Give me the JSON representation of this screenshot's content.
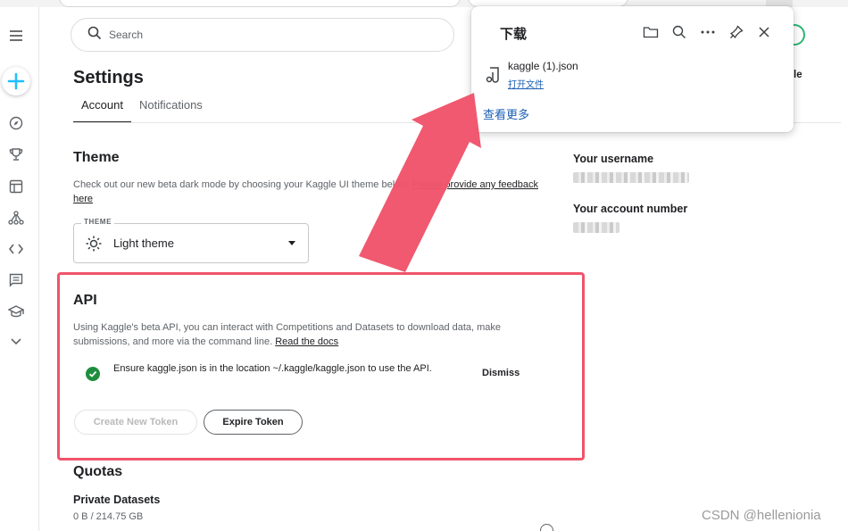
{
  "search": {
    "placeholder": "Search"
  },
  "page": {
    "title": "Settings"
  },
  "tabs": [
    {
      "label": "Account",
      "active": true
    },
    {
      "label": "Notifications",
      "active": false
    }
  ],
  "theme": {
    "heading": "Theme",
    "desc_text": "Check out our new beta dark mode by choosing your Kaggle UI theme below.",
    "desc_link": "Please provide any feedback here",
    "select_legend": "THEME",
    "select_value": "Light theme"
  },
  "account": {
    "username_label": "Your username",
    "number_label": "Your account number"
  },
  "api": {
    "heading": "API",
    "desc_text": "Using Kaggle's beta API, you can interact with Competitions and Datasets to download data, make submissions, and more via the command line.",
    "desc_link": "Read the docs",
    "notice": "Ensure kaggle.json is in the location ~/.kaggle/kaggle.json to use the API.",
    "dismiss": "Dismiss",
    "create_token": "Create New Token",
    "expire_token": "Expire Token"
  },
  "quotas": {
    "heading": "Quotas",
    "private_datasets_label": "Private Datasets",
    "private_datasets_value": "0 B / 214.75 GB"
  },
  "downloads": {
    "title": "下载",
    "file_name": "kaggle (1).json",
    "open_file": "打开文件",
    "see_more": "查看更多"
  },
  "header_partial": {
    "name_fragment": "le"
  },
  "watermark": "CSDN @hellenionia",
  "colors": {
    "accent_blue": "#20beff",
    "highlight_red": "#f0546a",
    "success_green": "#1e8e3e",
    "link_blue": "#1a5fb4"
  },
  "icons": {
    "rail": [
      "menu-icon",
      "create-plus-icon",
      "compass-icon",
      "trophy-icon",
      "table-icon",
      "models-icon",
      "code-icon",
      "discussion-icon",
      "learn-icon",
      "chevron-down-icon"
    ],
    "downloads_toolbar": [
      "folder-icon",
      "search-icon",
      "more-icon",
      "pin-icon",
      "close-icon"
    ]
  }
}
